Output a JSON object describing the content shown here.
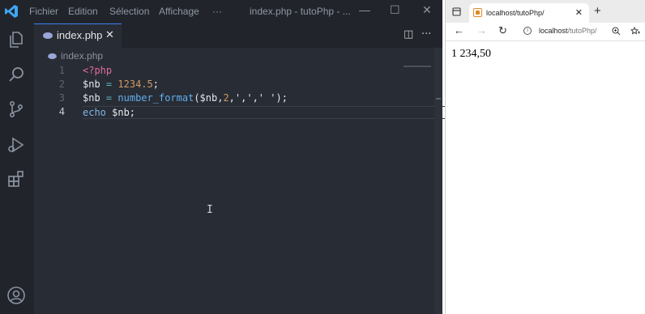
{
  "vscode": {
    "menu": [
      "Fichier",
      "Edition",
      "Sélection",
      "Affichage",
      "···"
    ],
    "window_title": "index.php - tutoPhp - ...",
    "controls": {
      "minimize": "—",
      "maximize": "☐",
      "close": "✕"
    },
    "tab": {
      "label": "index.php",
      "close": "✕"
    },
    "tab_actions": {
      "split": "◫",
      "more": "···"
    },
    "breadcrumb": "index.php",
    "code_lines": [
      {
        "num": "1",
        "text": "<?php"
      },
      {
        "num": "2",
        "text": "$nb = 1234.5;"
      },
      {
        "num": "3",
        "text": "$nb = number_format($nb,2,',',' ');"
      },
      {
        "num": "4",
        "text": "echo $nb;"
      }
    ],
    "cursor": "I",
    "colors": {
      "keyword": "#e06c9f",
      "function": "#61afef",
      "number": "#d19a66",
      "operator": "#56b6c2",
      "accent": "#3b82f6"
    }
  },
  "browser": {
    "tab_title": "localhost/tutoPhp/",
    "tab_close": "✕",
    "new_tab": "+",
    "nav": {
      "back": "←",
      "forward": "→",
      "reload": "↻"
    },
    "url_host": "localhost",
    "url_path": "/tutoPhp/",
    "output": "1 234,50"
  }
}
